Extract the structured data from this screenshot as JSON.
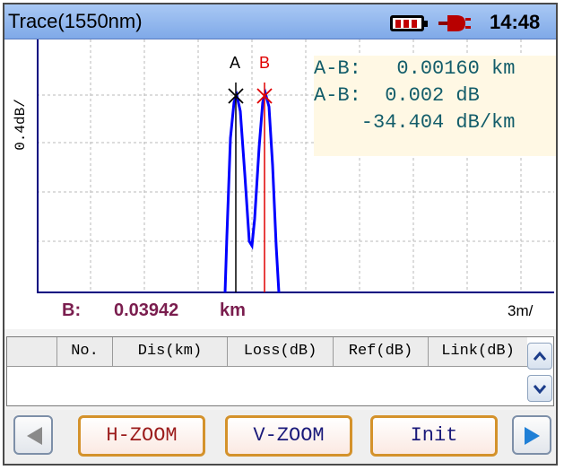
{
  "title": "Trace(1550nm)",
  "status": {
    "battery_icon": "battery-icon",
    "power_icon": "ac-plug-icon",
    "time": "14:48"
  },
  "plot": {
    "y_scale_label": "0.4dB/",
    "x_scale_label": "3m/",
    "marker_a_label": "A",
    "marker_b_label": "B",
    "marker_a_color": "#000000",
    "marker_b_color": "#e00000",
    "trace_color": "#0000ff",
    "grid_color": "#b8b8b8",
    "readout": {
      "line1": "A-B:   0.00160 km",
      "line2": "A-B:  0.002 dB",
      "line3": "    -34.404 dB/km"
    }
  },
  "cursor": {
    "label": "B:",
    "value": "0.03942",
    "unit": "km"
  },
  "table": {
    "columns": [
      "",
      "No.",
      "Dis(km)",
      "Loss(dB)",
      "Ref(dB)",
      "Link(dB)"
    ],
    "rows": []
  },
  "toolbar": {
    "prev_icon": "left-arrow-icon",
    "next_icon": "right-arrow-icon",
    "buttons": [
      {
        "label": "H-ZOOM",
        "color": "#9b1b1b"
      },
      {
        "label": "V-ZOOM",
        "color": "#1a1a7a"
      },
      {
        "label": "Init",
        "color": "#1a1a7a"
      }
    ]
  }
}
